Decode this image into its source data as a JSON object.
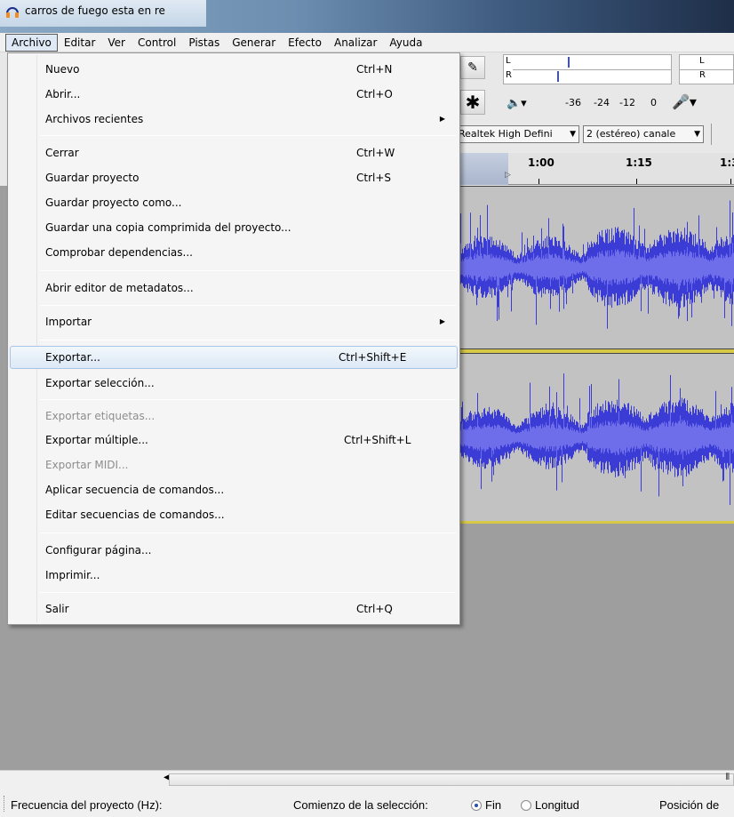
{
  "window": {
    "title": "carros de fuego esta en re"
  },
  "menubar": [
    "Archivo",
    "Editar",
    "Ver",
    "Control",
    "Pistas",
    "Generar",
    "Efecto",
    "Analizar",
    "Ayuda"
  ],
  "file_menu": {
    "items": [
      {
        "label": "Nuevo",
        "shortcut": "Ctrl+N"
      },
      {
        "label": "Abrir...",
        "shortcut": "Ctrl+O"
      },
      {
        "label": "Archivos recientes",
        "shortcut": ""
      },
      {
        "label": "Cerrar",
        "shortcut": "Ctrl+W"
      },
      {
        "label": "Guardar proyecto",
        "shortcut": "Ctrl+S"
      },
      {
        "label": "Guardar proyecto como...",
        "shortcut": ""
      },
      {
        "label": "Guardar una copia comprimida del proyecto...",
        "shortcut": ""
      },
      {
        "label": "Comprobar dependencias...",
        "shortcut": ""
      },
      {
        "label": "Abrir editor de metadatos...",
        "shortcut": ""
      },
      {
        "label": "Importar",
        "shortcut": ""
      },
      {
        "label": "Exportar...",
        "shortcut": "Ctrl+Shift+E"
      },
      {
        "label": "Exportar selección...",
        "shortcut": ""
      },
      {
        "label": "Exportar etiquetas...",
        "shortcut": ""
      },
      {
        "label": "Exportar múltiple...",
        "shortcut": "Ctrl+Shift+L"
      },
      {
        "label": "Exportar MIDI...",
        "shortcut": ""
      },
      {
        "label": "Aplicar secuencia de comandos...",
        "shortcut": ""
      },
      {
        "label": "Editar secuencias de comandos...",
        "shortcut": ""
      },
      {
        "label": "Configurar página...",
        "shortcut": ""
      },
      {
        "label": "Imprimir...",
        "shortcut": ""
      },
      {
        "label": "Salir",
        "shortcut": "Ctrl+Q"
      }
    ]
  },
  "meters": {
    "left_label": "L",
    "right_label": "R",
    "db_scale": [
      "-36",
      "-24",
      "-12",
      "0"
    ]
  },
  "devices": {
    "output_device": "Realtek High Defini",
    "channels": "2 (estéreo) canale"
  },
  "timeline": {
    "labels": [
      "1:00",
      "1:15",
      "1:3"
    ]
  },
  "statusbar": {
    "project_rate_label": "Frecuencia del proyecto (Hz):",
    "selection_start_label": "Comienzo de la selección:",
    "end_option": "Fin",
    "length_option": "Longitud",
    "position_label": "Posición de"
  },
  "colors": {
    "waveform": "#3b3bd6",
    "waveform_rms": "#6e6eea",
    "track_bg": "#c2c2c2",
    "menu_hover": "#dde9f6"
  }
}
